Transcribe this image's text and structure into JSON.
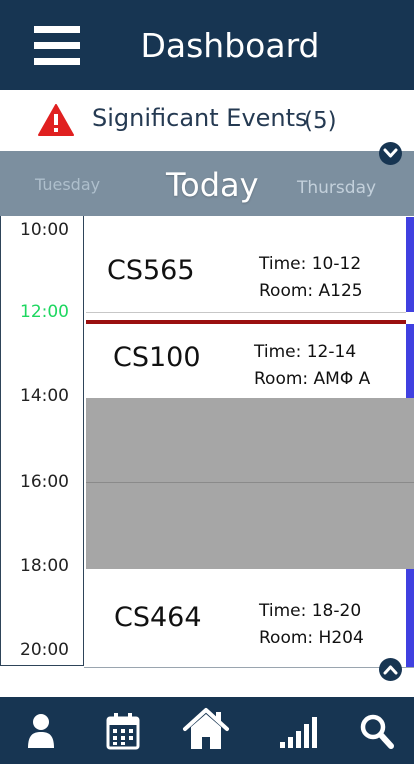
{
  "header": {
    "title": "Dashboard",
    "menu_icon": "hamburger-menu-icon"
  },
  "events_banner": {
    "icon": "warning-triangle-icon",
    "label": "Significant Events",
    "count": "(5)"
  },
  "day_nav": {
    "previous": "Tuesday",
    "current": "Today",
    "next": "Thursday"
  },
  "timeline": {
    "times": [
      "10:00",
      "12:00",
      "14:00",
      "16:00",
      "18:00",
      "20:00"
    ],
    "current_time": "12:00"
  },
  "events": [
    {
      "code": "CS565",
      "time": "Time: 10-12",
      "room": "Room: A125"
    },
    {
      "code": "CS100",
      "time": "Time: 12-14",
      "room": "Room: ΑΜΦ Α"
    },
    {
      "code": "CS464",
      "time": "Time: 18-20",
      "room": "Room: H204"
    }
  ],
  "bottom_nav": [
    {
      "icon": "profile-icon"
    },
    {
      "icon": "calendar-icon"
    },
    {
      "icon": "home-icon"
    },
    {
      "icon": "signal-bars-icon"
    },
    {
      "icon": "search-icon"
    }
  ],
  "colors": {
    "primary": "#173552",
    "day_bar": "#7c8f9f",
    "accent_stripe": "#4040e0",
    "now_line": "#9a1010",
    "now_text": "#1ed760",
    "busy_block": "#a6a6a6",
    "warning": "#e02020"
  }
}
